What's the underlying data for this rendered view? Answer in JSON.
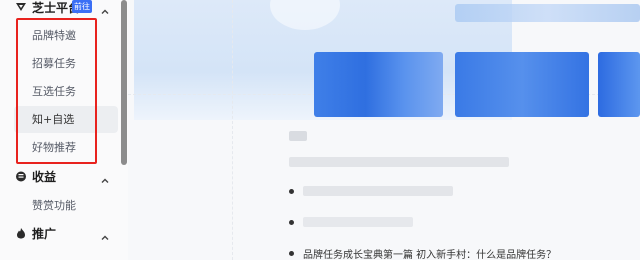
{
  "sidebar": {
    "sections": [
      {
        "key": "zhishi",
        "label": "芝士平台",
        "badge": "前往",
        "icon": "zhishi-logo-icon",
        "expanded": true
      },
      {
        "key": "income",
        "label": "收益",
        "icon": "wallet-icon",
        "expanded": true
      },
      {
        "key": "promo",
        "label": "推广",
        "icon": "flame-icon",
        "expanded": true
      }
    ],
    "zhishi_items": [
      "品牌特邀",
      "招募任务",
      "互选任务",
      "知+自选",
      "好物推荐"
    ],
    "income_items": [
      "赞赏功能"
    ],
    "active_item": "知+自选",
    "highlight_color": "#e8221e"
  },
  "main": {
    "bullet_items": [
      "",
      "",
      "品牌任务成长宝典第一篇 初入新手村：什么是品牌任务？"
    ],
    "accent_color": "#3b6ff5"
  }
}
